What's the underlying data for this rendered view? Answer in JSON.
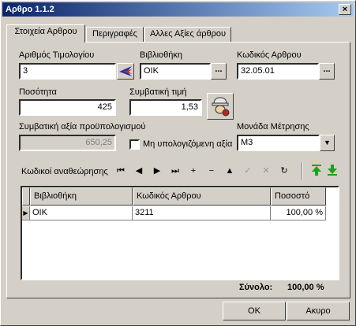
{
  "window": {
    "title": "Αρθρο 1.1.2",
    "close_glyph": "×"
  },
  "tabs": [
    {
      "label": "Στοιχεία Αρθρου"
    },
    {
      "label": "Περιγραφές"
    },
    {
      "label": "Αλλες Αξίες άρθρου"
    }
  ],
  "form": {
    "invoice_number": {
      "label": "Αριθμός Τιμολογίου",
      "value": "3"
    },
    "library": {
      "label": "Βιβλιοθήκη",
      "value": "OIK",
      "button": "..."
    },
    "item_code": {
      "label": "Κωδικός Αρθρου",
      "value": "32.05.01",
      "button": "..."
    },
    "quantity": {
      "label": "Ποσότητα",
      "value": "425"
    },
    "contract_price": {
      "label": "Συμβατική τιμή",
      "value": "1,53"
    },
    "budget_value": {
      "label": "Συμβατική αξία προϋπολογισμού",
      "value": "650,25"
    },
    "non_calc_value": {
      "label": "Μη υπολογιζόμενη αξία",
      "checked": false
    },
    "unit": {
      "label": "Μονάδα Μέτρησης",
      "value": "M3"
    }
  },
  "recalc": {
    "label": "Κωδικοί αναθεώρησης",
    "nav": [
      {
        "icon": "first-record-icon",
        "glyph": "⏮",
        "enabled": true
      },
      {
        "icon": "prior-record-icon",
        "glyph": "◀",
        "enabled": true
      },
      {
        "icon": "next-record-icon",
        "glyph": "▶",
        "enabled": true
      },
      {
        "icon": "last-record-icon",
        "glyph": "⏭",
        "enabled": true
      },
      {
        "icon": "insert-record-icon",
        "glyph": "+",
        "enabled": true
      },
      {
        "icon": "delete-record-icon",
        "glyph": "−",
        "enabled": true
      },
      {
        "icon": "edit-record-icon",
        "glyph": "▲",
        "enabled": true
      },
      {
        "icon": "post-record-icon",
        "glyph": "✓",
        "enabled": false
      },
      {
        "icon": "cancel-record-icon",
        "glyph": "✕",
        "enabled": false
      },
      {
        "icon": "refresh-icon",
        "glyph": "↻",
        "enabled": true
      }
    ],
    "columns": [
      "Βιβλιοθήκη",
      "Κωδικός Αρθρου",
      "Ποσοστό"
    ],
    "rows": [
      {
        "library": "OIK",
        "code": "3211",
        "percent": "100,00 %"
      }
    ],
    "row_indicator": "▶"
  },
  "total": {
    "label": "Σύνολο:",
    "value": "100,00 %"
  },
  "buttons": {
    "ok": "OK",
    "cancel": "Ακυρο"
  },
  "colors": {
    "title_start": "#0a246a",
    "title_end": "#a6caf0",
    "green_arrow": "#1aa31a"
  }
}
